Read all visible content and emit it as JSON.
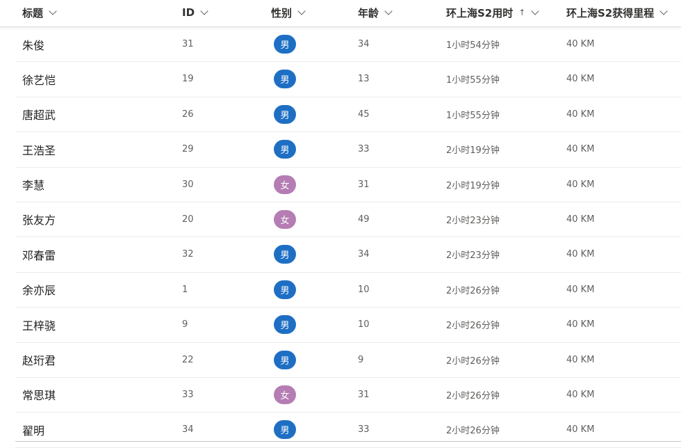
{
  "columns": {
    "title": "标题",
    "id": "ID",
    "gender": "性别",
    "age": "年龄",
    "time": "环上海S2用时",
    "time_sort": "↑",
    "km": "环上海S2获得里程"
  },
  "colors": {
    "male_pill": "#1e6fc4",
    "female_pill": "#b57db3"
  },
  "rows": [
    {
      "title": "朱俊",
      "id": "31",
      "gender": "男",
      "gender_type": "male",
      "age": "34",
      "time": "1小时54分钟",
      "km": "40 KM"
    },
    {
      "title": "徐艺恺",
      "id": "19",
      "gender": "男",
      "gender_type": "male",
      "age": "13",
      "time": "1小时55分钟",
      "km": "40 KM"
    },
    {
      "title": "唐超武",
      "id": "26",
      "gender": "男",
      "gender_type": "male",
      "age": "45",
      "time": "1小时55分钟",
      "km": "40 KM"
    },
    {
      "title": "王浩圣",
      "id": "29",
      "gender": "男",
      "gender_type": "male",
      "age": "33",
      "time": "2小时19分钟",
      "km": "40 KM"
    },
    {
      "title": "李慧",
      "id": "30",
      "gender": "女",
      "gender_type": "female",
      "age": "31",
      "time": "2小时19分钟",
      "km": "40 KM"
    },
    {
      "title": "张友方",
      "id": "20",
      "gender": "女",
      "gender_type": "female",
      "age": "49",
      "time": "2小时23分钟",
      "km": "40 KM"
    },
    {
      "title": "邓春雷",
      "id": "32",
      "gender": "男",
      "gender_type": "male",
      "age": "34",
      "time": "2小时23分钟",
      "km": "40 KM"
    },
    {
      "title": "余亦辰",
      "id": "1",
      "gender": "男",
      "gender_type": "male",
      "age": "10",
      "time": "2小时26分钟",
      "km": "40 KM"
    },
    {
      "title": "王梓骁",
      "id": "9",
      "gender": "男",
      "gender_type": "male",
      "age": "10",
      "time": "2小时26分钟",
      "km": "40 KM"
    },
    {
      "title": "赵珩君",
      "id": "22",
      "gender": "男",
      "gender_type": "male",
      "age": "9",
      "time": "2小时26分钟",
      "km": "40 KM"
    },
    {
      "title": "常思琪",
      "id": "33",
      "gender": "女",
      "gender_type": "female",
      "age": "31",
      "time": "2小时26分钟",
      "km": "40 KM"
    },
    {
      "title": "翟明",
      "id": "34",
      "gender": "男",
      "gender_type": "male",
      "age": "33",
      "time": "2小时26分钟",
      "km": "40 KM"
    }
  ]
}
